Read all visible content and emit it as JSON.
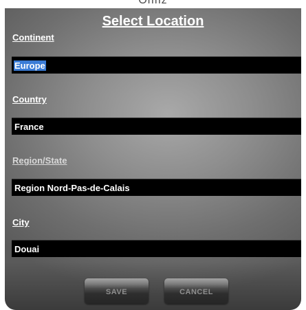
{
  "window": {
    "top_text": "Onfiz"
  },
  "dialog": {
    "title": "Select Location",
    "fields": {
      "continent": {
        "label": "Continent",
        "value": "Europe"
      },
      "country": {
        "label": "Country",
        "value": "France"
      },
      "region": {
        "label": "Region/State",
        "value": "Region Nord-Pas-de-Calais"
      },
      "city": {
        "label": "City",
        "value": "Douai"
      }
    },
    "buttons": {
      "save": "SAVE",
      "cancel": "CANCEL"
    }
  },
  "icons": {
    "dropdown": "chevron-down-icon"
  },
  "colors": {
    "selection_highlight": "#3a7cd6",
    "select_bg": "#000000",
    "label": "#ffffff"
  }
}
